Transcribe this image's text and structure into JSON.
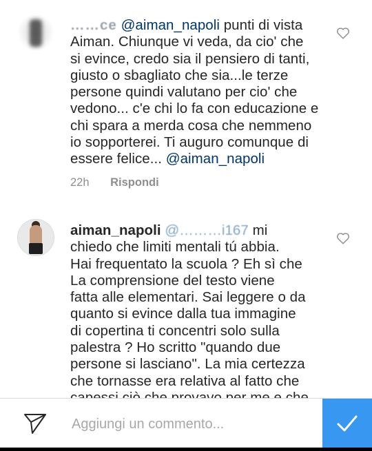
{
  "comments": [
    {
      "username": "……ce",
      "mention": "@aiman_napoli",
      "lines": [
        " punti di vista",
        "Aiman. Chiunque vi veda, da cio' che",
        "si evince, credo sia il pensiero di tanti,",
        "giusto o sbagliato che sia...le terze",
        "persone quindi valutano per cio' che",
        "vedono... c'e chi lo fa con educazione e",
        "chi spara a merda cosa che nemmeno",
        "io sopporterei. Ti auguro comunque di",
        "essere felice... "
      ],
      "trailing_mention": "@aiman_napoli",
      "time": "22h",
      "reply_label": "Rispondi"
    },
    {
      "username": "aiman_napoli",
      "mention": "@………i167",
      "lines": [
        " mi",
        "chiedo che limiti mentali tú abbia.",
        "Hai frequentato la scuola ? Eh sì che",
        "La comprensione del testo viene",
        "fatta alle elementari. Sai leggere o da",
        "quanto si evince dalla tua immagine",
        "di copertina ti concentri solo sulla",
        "palestra ? Ho scritto \"quando due",
        "persone si lasciano\". La mia certezza",
        "che tornasse era relativa al fatto che",
        "capessi ciò che provavo per me e che"
      ]
    }
  ],
  "composer": {
    "placeholder": "Aggiungi un commento..."
  },
  "colors": {
    "accent": "#3897f0",
    "mention": "#003569",
    "meta": "#8e8e8e"
  },
  "icons": [
    "heart-icon",
    "send-icon",
    "checkmark-icon"
  ]
}
